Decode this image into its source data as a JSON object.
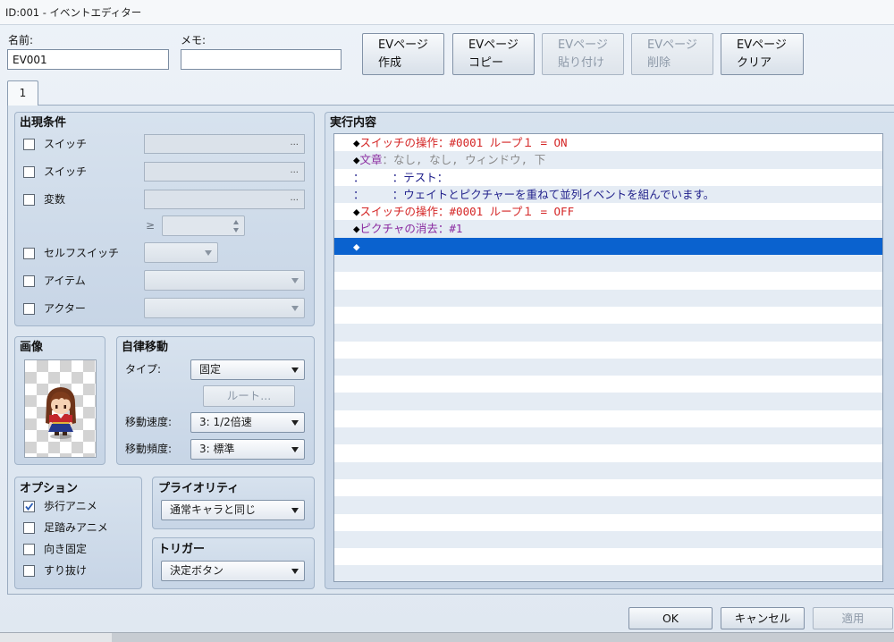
{
  "window": {
    "title": "ID:001 - イベントエディター"
  },
  "header": {
    "name_label": "名前:",
    "name_value": "EV001",
    "memo_label": "メモ:",
    "memo_value": "",
    "page_buttons": [
      {
        "line1": "EVページ",
        "line2": "作成",
        "enabled": true
      },
      {
        "line1": "EVページ",
        "line2": "コピー",
        "enabled": true
      },
      {
        "line1": "EVページ",
        "line2": "貼り付け",
        "enabled": false
      },
      {
        "line1": "EVページ",
        "line2": "削除",
        "enabled": false
      },
      {
        "line1": "EVページ",
        "line2": "クリア",
        "enabled": true
      }
    ]
  },
  "tabs": [
    {
      "label": "1",
      "active": true
    }
  ],
  "conditions": {
    "title": "出現条件",
    "switch_1": {
      "label": "スイッチ",
      "checked": false,
      "browse": "..."
    },
    "switch_2": {
      "label": "スイッチ",
      "checked": false,
      "browse": "..."
    },
    "variable": {
      "label": "変数",
      "checked": false,
      "browse": "...",
      "operator": "≥"
    },
    "self_switch": {
      "label": "セルフスイッチ",
      "checked": false
    },
    "item": {
      "label": "アイテム",
      "checked": false
    },
    "actor": {
      "label": "アクター",
      "checked": false
    }
  },
  "image": {
    "title": "画像"
  },
  "autonomous_movement": {
    "title": "自律移動",
    "type_label": "タイプ:",
    "type_value": "固定",
    "route_button": "ルート...",
    "route_enabled": false,
    "speed_label": "移動速度:",
    "speed_value": "3: 1/2倍速",
    "frequency_label": "移動頻度:",
    "frequency_value": "3: 標準"
  },
  "options": {
    "title": "オプション",
    "items": [
      {
        "label": "歩行アニメ",
        "checked": true
      },
      {
        "label": "足踏みアニメ",
        "checked": false
      },
      {
        "label": "向き固定",
        "checked": false
      },
      {
        "label": "すり抜け",
        "checked": false
      }
    ]
  },
  "priority": {
    "title": "プライオリティ",
    "value": "通常キャラと同じ"
  },
  "trigger": {
    "title": "トリガー",
    "value": "決定ボタン"
  },
  "contents": {
    "title": "実行内容",
    "selected_index": 6,
    "commands": [
      {
        "segments": [
          {
            "text": "◆",
            "color": "#000000"
          },
          {
            "text": "スイッチの操作：#0001 ループ１ = ON",
            "color": "#d42525"
          }
        ]
      },
      {
        "segments": [
          {
            "text": "◆",
            "color": "#000000"
          },
          {
            "text": "文章",
            "color": "#8a2aa0"
          },
          {
            "text": "：なし, なし, ウィンドウ, 下",
            "color": "#8a8a8a"
          }
        ]
      },
      {
        "segments": [
          {
            "text": "：　　　：テスト：",
            "color": "#22228c"
          }
        ]
      },
      {
        "segments": [
          {
            "text": "：　　　：ウェイトとピクチャーを重ねて並列イベントを組んでいます。",
            "color": "#22228c"
          }
        ]
      },
      {
        "segments": [
          {
            "text": "◆",
            "color": "#000000"
          },
          {
            "text": "スイッチの操作：#0001 ループ１ = OFF",
            "color": "#d42525"
          }
        ]
      },
      {
        "segments": [
          {
            "text": "◆",
            "color": "#000000"
          },
          {
            "text": "ピクチャの消去：#1",
            "color": "#8a2aa0"
          }
        ]
      },
      {
        "segments": [
          {
            "text": "◆",
            "color": "#ffffff"
          }
        ]
      }
    ]
  },
  "footer": {
    "ok": "OK",
    "cancel": "キャンセル",
    "apply": "適用",
    "apply_enabled": false
  },
  "colors": {
    "selection": "#0a62cf",
    "checkmark": "#2a5db5",
    "window_bg": "#e6edf5"
  },
  "icons": {
    "dropdown": "chevron-down-icon",
    "spin_up": "spin-up-icon",
    "spin_down": "spin-down-icon",
    "check": "checkmark-icon",
    "sprite": "character-sprite"
  }
}
